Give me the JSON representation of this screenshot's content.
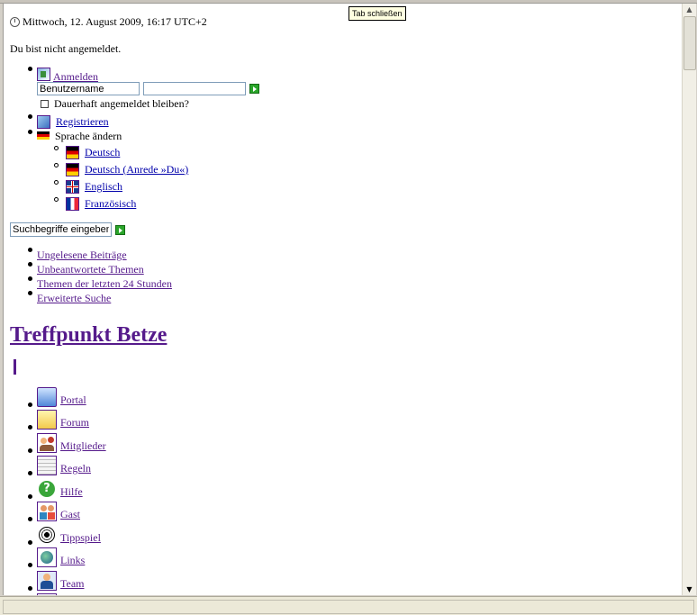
{
  "tooltip": {
    "text": "Tab schließen"
  },
  "header": {
    "datetime": "Mittwoch, 12. August 2009, 16:17 UTC+2",
    "login_status": "Du bist nicht angemeldet."
  },
  "login": {
    "label": "Anmelden",
    "username_value": "Benutzername",
    "password_value": "",
    "remember_label": "Dauerhaft angemeldet bleiben?"
  },
  "register": {
    "label": "Registrieren"
  },
  "language": {
    "label": "Sprache ändern",
    "options": [
      {
        "label": "Deutsch"
      },
      {
        "label": "Deutsch (Anrede »Du«)"
      },
      {
        "label": "Englisch"
      },
      {
        "label": "Französisch"
      }
    ]
  },
  "search": {
    "value": "Suchbegriffe eingeben"
  },
  "quick_links": [
    {
      "label": "Ungelesene Beiträge"
    },
    {
      "label": "Unbeantwortete Themen"
    },
    {
      "label": "Themen der letzten 24 Stunden"
    },
    {
      "label": "Erweiterte Suche"
    }
  ],
  "site": {
    "title": "Treffpunkt Betze"
  },
  "nav": [
    {
      "label": "Portal",
      "icon": "portal-icon"
    },
    {
      "label": "Forum",
      "icon": "forum-folder-icon"
    },
    {
      "label": "Mitglieder",
      "icon": "members-icon"
    },
    {
      "label": "Regeln",
      "icon": "rules-icon"
    },
    {
      "label": "Hilfe",
      "icon": "help-icon"
    },
    {
      "label": "Gast",
      "icon": "guest-icon"
    },
    {
      "label": "Tippspiel",
      "icon": "football-icon"
    },
    {
      "label": "Links",
      "icon": "globe-icon"
    },
    {
      "label": "Team",
      "icon": "team-icon"
    }
  ],
  "colors": {
    "link": "#551a8b",
    "go_button": "#2aa52a",
    "tooltip_bg": "#ffffe1"
  }
}
